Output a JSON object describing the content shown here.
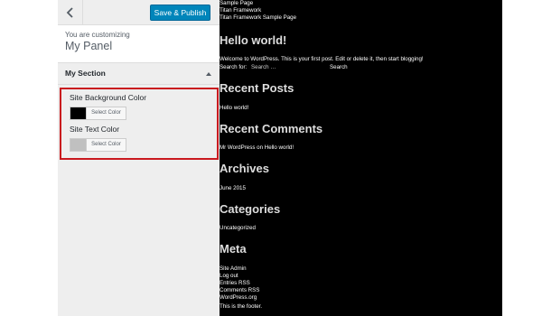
{
  "colors": {
    "publish_bg": "#0085ba",
    "highlight_border": "#c9191e",
    "background_swatch": "#000000",
    "text_swatch": "#c0c0c0",
    "preview_bg": "#000000"
  },
  "customizer": {
    "back_icon": "chevron-left-icon",
    "publish_label": "Save & Publish",
    "customizing_label": "You are customizing",
    "panel_title": "My Panel",
    "section_title": "My Section",
    "controls": [
      {
        "label": "Site Background Color",
        "button_label": "Select Color"
      },
      {
        "label": "Site Text Color",
        "button_label": "Select Color"
      }
    ]
  },
  "preview": {
    "top_links": [
      "Sample Page",
      "Titan Framework",
      "Titan Framework Sample Page"
    ],
    "post_title": "Hello world!",
    "post_content": "Welcome to WordPress. This is your first post. Edit or delete it, then start blogging!",
    "search_label": "Search for:",
    "search_placeholder": "Search …",
    "search_button": "Search",
    "recent_posts_title": "Recent Posts",
    "recent_posts": [
      "Hello world!"
    ],
    "recent_comments_title": "Recent Comments",
    "recent_comments": [
      "Mr WordPress on Hello world!"
    ],
    "archives_title": "Archives",
    "archives": [
      "June 2015"
    ],
    "categories_title": "Categories",
    "categories": [
      "Uncategorized"
    ],
    "meta_title": "Meta",
    "meta_links": [
      "Site Admin",
      "Log out",
      "Entries RSS",
      "Comments RSS",
      "WordPress.org"
    ],
    "footer": "This is the footer."
  }
}
